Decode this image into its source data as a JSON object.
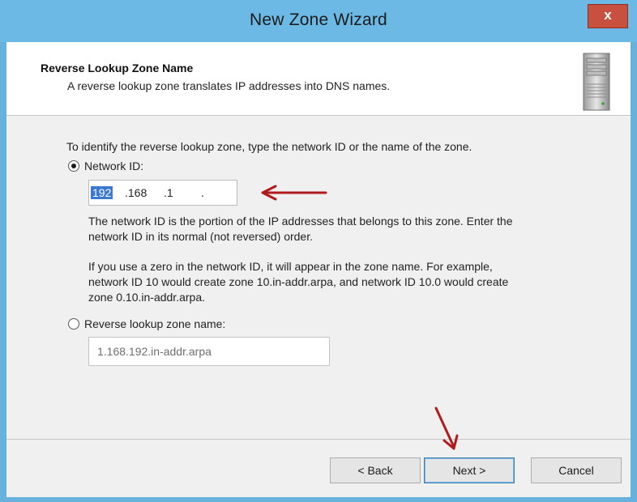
{
  "window": {
    "title": "New Zone Wizard",
    "close_glyph": "x"
  },
  "header": {
    "title": "Reverse Lookup Zone Name",
    "subtitle": "A reverse lookup zone translates IP addresses into DNS names.",
    "icon": "server-icon"
  },
  "main": {
    "instruction": "To identify the reverse lookup zone, type the network ID or the name of the zone.",
    "network_id": {
      "label": "Network ID:",
      "selected": true,
      "octets": [
        "192",
        ".168",
        ".1",
        "."
      ]
    },
    "description_1": [
      "The network ID is the portion of the IP addresses that belongs to this zone. Enter the",
      "network ID in its normal (not reversed) order."
    ],
    "description_2": [
      "If you use a zero in the network ID, it will appear in the zone name. For example,",
      "network ID 10 would create zone 10.in-addr.arpa, and network ID 10.0 would create",
      "zone 0.10.in-addr.arpa."
    ],
    "reverse_zone": {
      "label": "Reverse lookup zone name:",
      "selected": false,
      "value": "1.168.192.in-addr.arpa"
    }
  },
  "footer": {
    "back_label": "< Back",
    "next_label": "Next >",
    "cancel_label": "Cancel"
  },
  "annotations": {
    "arrow_color": "#b01c1c"
  }
}
